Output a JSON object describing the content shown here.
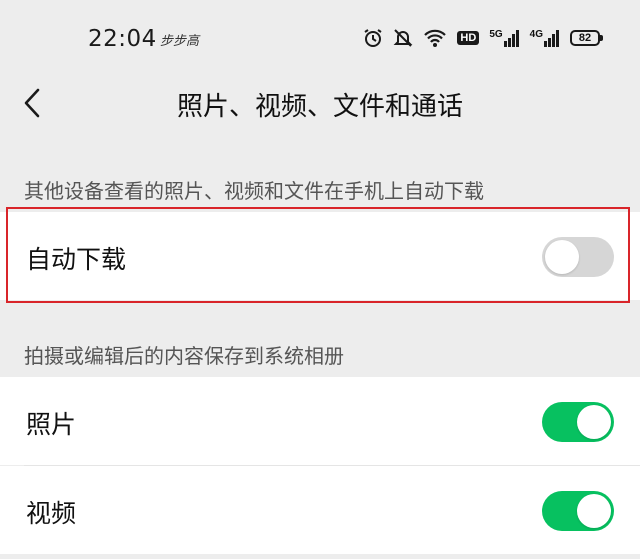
{
  "status_bar": {
    "time": "22:04",
    "extra": "步步高",
    "hd_badge": "HD",
    "signal_5g": "5G",
    "signal_4g": "4G",
    "battery": "82"
  },
  "nav": {
    "title": "照片、视频、文件和通话"
  },
  "sections": [
    {
      "header": "其他设备查看的照片、视频和文件在手机上自动下载",
      "items": [
        {
          "label": "自动下载",
          "enabled": false
        }
      ]
    },
    {
      "header": "拍摄或编辑后的内容保存到系统相册",
      "items": [
        {
          "label": "照片",
          "enabled": true
        },
        {
          "label": "视频",
          "enabled": true
        }
      ]
    }
  ],
  "colors": {
    "toggle_on": "#07c160",
    "toggle_off": "#d6d6d6",
    "highlight": "#d9252a",
    "background": "#ededed"
  }
}
